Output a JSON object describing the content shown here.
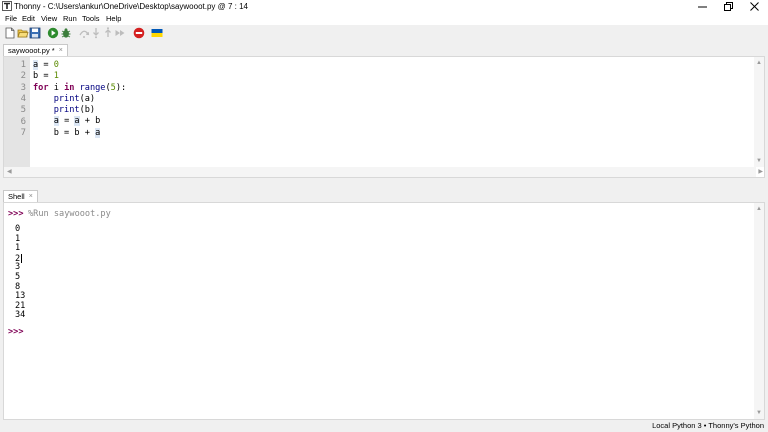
{
  "window": {
    "title": "Thonny  -  C:\\Users\\ankur\\OneDrive\\Desktop\\saywooot.py  @  7 : 14",
    "controls": [
      "minimize-icon",
      "restore-icon",
      "close-icon"
    ]
  },
  "menu": {
    "items": [
      "File",
      "Edit",
      "View",
      "Run",
      "Tools",
      "Help"
    ]
  },
  "toolbar": {
    "buttons": [
      "new-file-icon",
      "open-file-icon",
      "save-icon",
      "run-icon",
      "debug-icon",
      "step-over-icon",
      "step-into-icon",
      "step-out-icon",
      "resume-icon",
      "stop-icon",
      "ukraine-flag-icon"
    ],
    "colors": {
      "run": "#2e8b2e",
      "stop": "#d42020",
      "flag_blue": "#0057b7",
      "flag_yellow": "#ffd700"
    }
  },
  "editor": {
    "tab_label": "saywooot.py *",
    "tab_close": "×",
    "line_numbers": [
      "1",
      "2",
      "3",
      "4",
      "5",
      "6",
      "7"
    ]
  },
  "shell": {
    "tab_label": "Shell",
    "tab_close": "×",
    "prompt": ">>>",
    "run_command": "%Run saywooot.py",
    "output": [
      "0",
      "1",
      "1",
      "2",
      "3",
      "5",
      "8",
      "13",
      "21",
      "34"
    ],
    "final_prompt": ">>>"
  },
  "status": {
    "text": "Local Python 3  •  Thonny's Python"
  },
  "colors": {
    "keyword": "#7f0055",
    "number": "#5a8a00",
    "gutter": "#e4e4e4"
  }
}
